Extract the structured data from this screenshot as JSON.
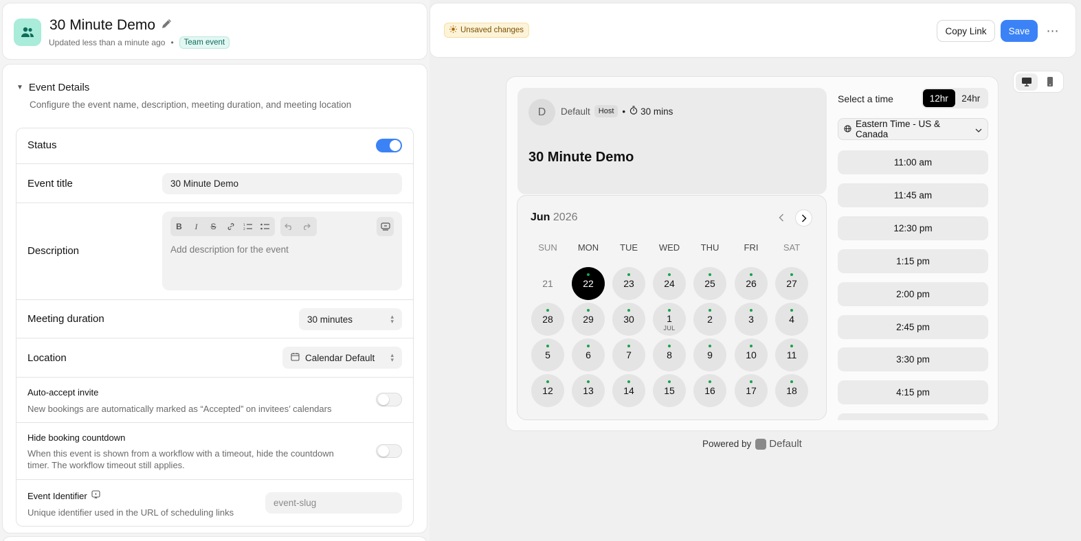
{
  "header": {
    "title": "30 Minute Demo",
    "updated": "Updated less than a minute ago",
    "team_badge": "Team event"
  },
  "section": {
    "title": "Event Details",
    "description": "Configure the event name, description, meeting duration, and meeting location"
  },
  "form": {
    "status_label": "Status",
    "status_on": true,
    "event_title_label": "Event title",
    "event_title_value": "30 Minute Demo",
    "description_label": "Description",
    "description_placeholder": "Add description for the event",
    "duration_label": "Meeting duration",
    "duration_value": "30 minutes",
    "location_label": "Location",
    "location_value": "Calendar Default",
    "auto_accept_label": "Auto-accept invite",
    "auto_accept_desc": "New bookings are automatically marked as “Accepted” on invitees’ calendars",
    "hide_countdown_label": "Hide booking countdown",
    "hide_countdown_desc": "When this event is shown from a workflow with a timeout, hide the countdown timer. The workflow timeout still applies.",
    "identifier_label": "Event Identifier",
    "identifier_desc": "Unique identifier used in the URL of scheduling links",
    "identifier_placeholder": "event-slug"
  },
  "topbar": {
    "unsaved": "Unsaved changes",
    "copy_link": "Copy Link",
    "save": "Save",
    "more": "⋯"
  },
  "preview": {
    "avatar_initial": "D",
    "host_name": "Default",
    "host_badge": "Host",
    "duration": "30 mins",
    "event_name": "30 Minute Demo",
    "month": "Jun",
    "year": "2026",
    "weekdays": [
      "SUN",
      "MON",
      "TUE",
      "WED",
      "THU",
      "FRI",
      "SAT"
    ],
    "days": [
      {
        "d": "21",
        "state": "inactive"
      },
      {
        "d": "22",
        "state": "selected",
        "dot": true
      },
      {
        "d": "23",
        "dot": true
      },
      {
        "d": "24",
        "dot": true
      },
      {
        "d": "25",
        "dot": true
      },
      {
        "d": "26",
        "dot": true
      },
      {
        "d": "27",
        "dot": true
      },
      {
        "d": "28",
        "dot": true
      },
      {
        "d": "29",
        "dot": true
      },
      {
        "d": "30",
        "dot": true
      },
      {
        "d": "1",
        "sub": "JUL",
        "dot": true
      },
      {
        "d": "2",
        "dot": true
      },
      {
        "d": "3",
        "dot": true
      },
      {
        "d": "4",
        "dot": true
      },
      {
        "d": "5",
        "dot": true
      },
      {
        "d": "6",
        "dot": true
      },
      {
        "d": "7",
        "dot": true
      },
      {
        "d": "8",
        "dot": true
      },
      {
        "d": "9",
        "dot": true
      },
      {
        "d": "10",
        "dot": true
      },
      {
        "d": "11",
        "dot": true
      },
      {
        "d": "12",
        "dot": true
      },
      {
        "d": "13",
        "dot": true
      },
      {
        "d": "14",
        "dot": true
      },
      {
        "d": "15",
        "dot": true
      },
      {
        "d": "16",
        "dot": true
      },
      {
        "d": "17",
        "dot": true
      },
      {
        "d": "18",
        "dot": true
      }
    ],
    "select_time": "Select a time",
    "format_12": "12hr",
    "format_24": "24hr",
    "timezone": "Eastern Time - US & Canada",
    "slots": [
      "11:00 am",
      "11:45 am",
      "12:30 pm",
      "1:15 pm",
      "2:00 pm",
      "2:45 pm",
      "3:30 pm",
      "4:15 pm"
    ],
    "powered_by": "Powered by",
    "brand": "Default"
  },
  "colors": {
    "accent": "#3b82f6",
    "app_icon_bg": "#a8ecd9",
    "available_dot": "#16a34a"
  }
}
